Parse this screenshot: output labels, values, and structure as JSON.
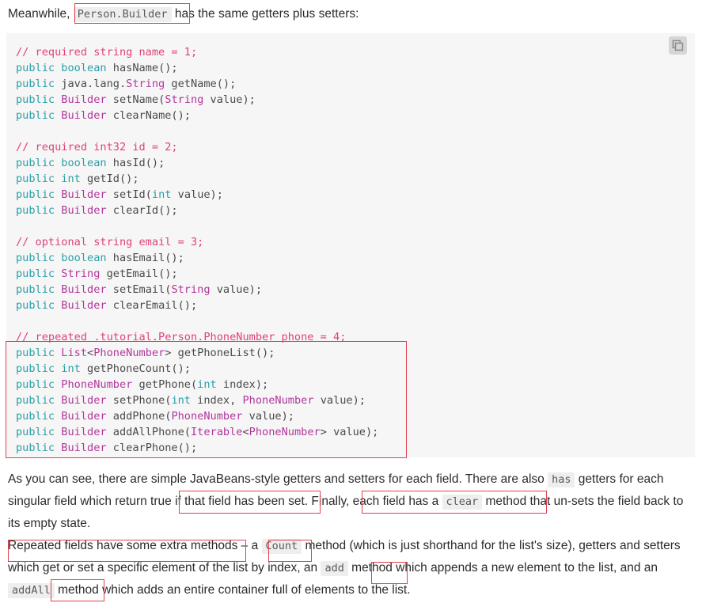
{
  "intro": {
    "before": "Meanwhile, ",
    "code": "Person.Builder",
    "after": " has the same getters plus setters:"
  },
  "codeblock": {
    "copy_button_label": "Copy",
    "copy_icon": "copy-icon",
    "lines": [
      {
        "tokens": [
          {
            "t": "// required string name = 1;",
            "c": "cm"
          }
        ]
      },
      {
        "tokens": [
          {
            "t": "public",
            "c": "kw"
          },
          {
            "t": " ",
            "c": "pn"
          },
          {
            "t": "boolean",
            "c": "kw"
          },
          {
            "t": " hasName();",
            "c": "id"
          }
        ]
      },
      {
        "tokens": [
          {
            "t": "public",
            "c": "kw"
          },
          {
            "t": " ",
            "c": "pn"
          },
          {
            "t": "java.lang.",
            "c": "id"
          },
          {
            "t": "String",
            "c": "ty"
          },
          {
            "t": " getName();",
            "c": "id"
          }
        ]
      },
      {
        "tokens": [
          {
            "t": "public",
            "c": "kw"
          },
          {
            "t": " ",
            "c": "pn"
          },
          {
            "t": "Builder",
            "c": "ty"
          },
          {
            "t": " setName(",
            "c": "id"
          },
          {
            "t": "String",
            "c": "ty"
          },
          {
            "t": " value);",
            "c": "id"
          }
        ]
      },
      {
        "tokens": [
          {
            "t": "public",
            "c": "kw"
          },
          {
            "t": " ",
            "c": "pn"
          },
          {
            "t": "Builder",
            "c": "ty"
          },
          {
            "t": " clearName();",
            "c": "id"
          }
        ]
      },
      {
        "tokens": []
      },
      {
        "tokens": [
          {
            "t": "// required int32 id = 2;",
            "c": "cm"
          }
        ]
      },
      {
        "tokens": [
          {
            "t": "public",
            "c": "kw"
          },
          {
            "t": " ",
            "c": "pn"
          },
          {
            "t": "boolean",
            "c": "kw"
          },
          {
            "t": " hasId();",
            "c": "id"
          }
        ]
      },
      {
        "tokens": [
          {
            "t": "public",
            "c": "kw"
          },
          {
            "t": " ",
            "c": "pn"
          },
          {
            "t": "int",
            "c": "kw"
          },
          {
            "t": " getId();",
            "c": "id"
          }
        ]
      },
      {
        "tokens": [
          {
            "t": "public",
            "c": "kw"
          },
          {
            "t": " ",
            "c": "pn"
          },
          {
            "t": "Builder",
            "c": "ty"
          },
          {
            "t": " setId(",
            "c": "id"
          },
          {
            "t": "int",
            "c": "kw"
          },
          {
            "t": " value);",
            "c": "id"
          }
        ]
      },
      {
        "tokens": [
          {
            "t": "public",
            "c": "kw"
          },
          {
            "t": " ",
            "c": "pn"
          },
          {
            "t": "Builder",
            "c": "ty"
          },
          {
            "t": " clearId();",
            "c": "id"
          }
        ]
      },
      {
        "tokens": []
      },
      {
        "tokens": [
          {
            "t": "// optional string email = 3;",
            "c": "cm"
          }
        ]
      },
      {
        "tokens": [
          {
            "t": "public",
            "c": "kw"
          },
          {
            "t": " ",
            "c": "pn"
          },
          {
            "t": "boolean",
            "c": "kw"
          },
          {
            "t": " hasEmail();",
            "c": "id"
          }
        ]
      },
      {
        "tokens": [
          {
            "t": "public",
            "c": "kw"
          },
          {
            "t": " ",
            "c": "pn"
          },
          {
            "t": "String",
            "c": "ty"
          },
          {
            "t": " getEmail();",
            "c": "id"
          }
        ]
      },
      {
        "tokens": [
          {
            "t": "public",
            "c": "kw"
          },
          {
            "t": " ",
            "c": "pn"
          },
          {
            "t": "Builder",
            "c": "ty"
          },
          {
            "t": " setEmail(",
            "c": "id"
          },
          {
            "t": "String",
            "c": "ty"
          },
          {
            "t": " value);",
            "c": "id"
          }
        ]
      },
      {
        "tokens": [
          {
            "t": "public",
            "c": "kw"
          },
          {
            "t": " ",
            "c": "pn"
          },
          {
            "t": "Builder",
            "c": "ty"
          },
          {
            "t": " clearEmail();",
            "c": "id"
          }
        ]
      },
      {
        "tokens": []
      },
      {
        "tokens": [
          {
            "t": "// repeated .tutorial.Person.PhoneNumber phone = 4;",
            "c": "cm"
          }
        ]
      },
      {
        "tokens": [
          {
            "t": "public",
            "c": "kw"
          },
          {
            "t": " ",
            "c": "pn"
          },
          {
            "t": "List",
            "c": "ty"
          },
          {
            "t": "<",
            "c": "id"
          },
          {
            "t": "PhoneNumber",
            "c": "ty"
          },
          {
            "t": "> getPhoneList();",
            "c": "id"
          }
        ]
      },
      {
        "tokens": [
          {
            "t": "public",
            "c": "kw"
          },
          {
            "t": " ",
            "c": "pn"
          },
          {
            "t": "int",
            "c": "kw"
          },
          {
            "t": " getPhoneCount();",
            "c": "id"
          }
        ]
      },
      {
        "tokens": [
          {
            "t": "public",
            "c": "kw"
          },
          {
            "t": " ",
            "c": "pn"
          },
          {
            "t": "PhoneNumber",
            "c": "ty"
          },
          {
            "t": " getPhone(",
            "c": "id"
          },
          {
            "t": "int",
            "c": "kw"
          },
          {
            "t": " index);",
            "c": "id"
          }
        ]
      },
      {
        "tokens": [
          {
            "t": "public",
            "c": "kw"
          },
          {
            "t": " ",
            "c": "pn"
          },
          {
            "t": "Builder",
            "c": "ty"
          },
          {
            "t": " setPhone(",
            "c": "id"
          },
          {
            "t": "int",
            "c": "kw"
          },
          {
            "t": " index, ",
            "c": "id"
          },
          {
            "t": "PhoneNumber",
            "c": "ty"
          },
          {
            "t": " value);",
            "c": "id"
          }
        ]
      },
      {
        "tokens": [
          {
            "t": "public",
            "c": "kw"
          },
          {
            "t": " ",
            "c": "pn"
          },
          {
            "t": "Builder",
            "c": "ty"
          },
          {
            "t": " addPhone(",
            "c": "id"
          },
          {
            "t": "PhoneNumber",
            "c": "ty"
          },
          {
            "t": " value);",
            "c": "id"
          }
        ]
      },
      {
        "tokens": [
          {
            "t": "public",
            "c": "kw"
          },
          {
            "t": " ",
            "c": "pn"
          },
          {
            "t": "Builder",
            "c": "ty"
          },
          {
            "t": " addAllPhone(",
            "c": "id"
          },
          {
            "t": "Iterable",
            "c": "ty"
          },
          {
            "t": "<",
            "c": "id"
          },
          {
            "t": "PhoneNumber",
            "c": "ty"
          },
          {
            "t": "> value);",
            "c": "id"
          }
        ]
      },
      {
        "tokens": [
          {
            "t": "public",
            "c": "kw"
          },
          {
            "t": " ",
            "c": "pn"
          },
          {
            "t": "Builder",
            "c": "ty"
          },
          {
            "t": " clearPhone();",
            "c": "id"
          }
        ]
      }
    ]
  },
  "body1": {
    "seg1": "As you can see, there are simple JavaBeans-style getters and setters for each field. There are also ",
    "code1": "has",
    "seg2": " getters for each singular field which return true if that field has been set. Finally, each field has a ",
    "code2": "clear",
    "seg3": " method that un-sets the field back to its empty state."
  },
  "body2": {
    "seg1": "Repeated fields have some extra methods – a ",
    "code1": "Count",
    "seg2": " method (which is just shorthand for the list's size), getters and setters which get or set a specific element of the list by index, an ",
    "code2": "add",
    "seg3": " method which appends a new element to the list, and an ",
    "code3": "addAll",
    "seg4": " method which adds an entire container full of elements to the list."
  },
  "colors": {
    "annotation_red": "#e0414f",
    "comment": "#e0417a",
    "keyword": "#2aa0a8",
    "type": "#b2379c",
    "code_background": "#f6f6f6",
    "inline_code_background": "#eeeeee"
  }
}
